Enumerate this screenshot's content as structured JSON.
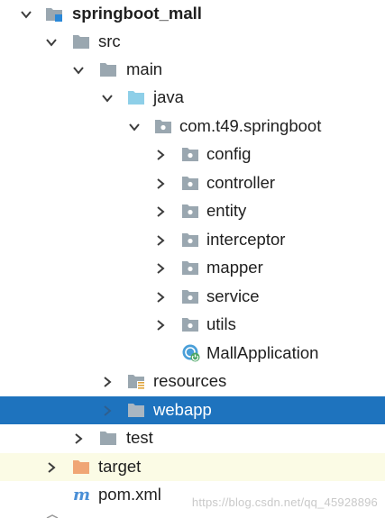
{
  "tree": {
    "root": {
      "label": "springboot_mall"
    },
    "src": {
      "label": "src"
    },
    "main": {
      "label": "main"
    },
    "java": {
      "label": "java"
    },
    "pkg": {
      "label": "com.t49.springboot"
    },
    "packages": [
      "config",
      "controller",
      "entity",
      "interceptor",
      "mapper",
      "service",
      "utils"
    ],
    "app_class": {
      "label": "MallApplication"
    },
    "resources": {
      "label": "resources"
    },
    "webapp": {
      "label": "webapp"
    },
    "test": {
      "label": "test"
    },
    "target": {
      "label": "target"
    },
    "pom": {
      "label": "pom.xml"
    }
  },
  "watermark": "https://blog.csdn.net/qq_45928896",
  "colors": {
    "selection": "#1e73be",
    "target_highlight": "#fbfbe5",
    "folder": "#9aa7b0",
    "source_folder": "#8ecfe8",
    "excluded_folder": "#f0a675",
    "maven": "#4a8fd6"
  }
}
